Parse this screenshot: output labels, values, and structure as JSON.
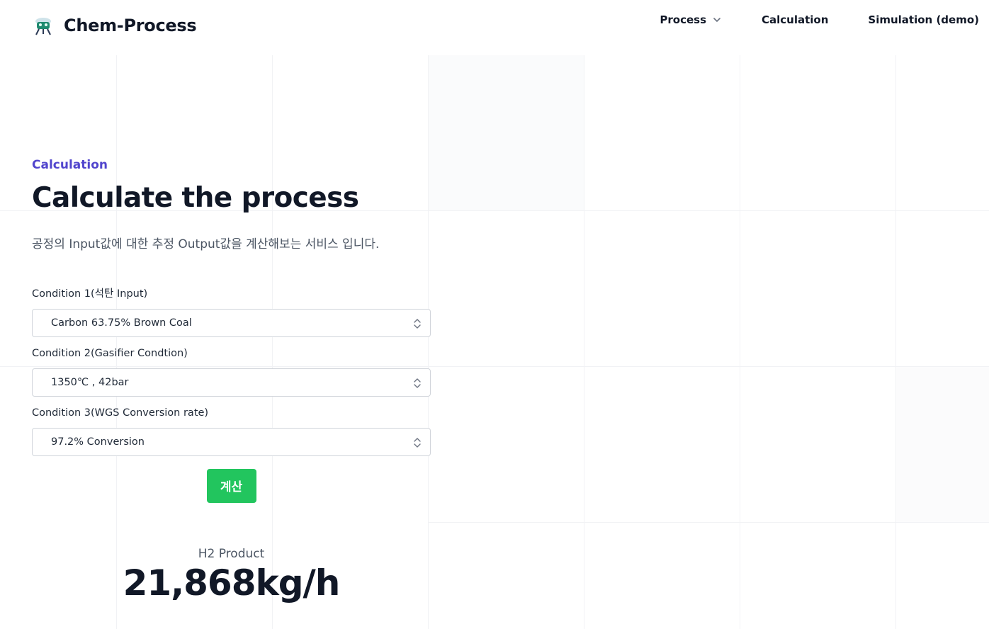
{
  "app": {
    "title": "Chem-Process",
    "logo_icon": "telescope-robot-icon"
  },
  "nav": {
    "items": [
      {
        "label": "Process",
        "has_dropdown": true
      },
      {
        "label": "Calculation"
      },
      {
        "label": "Simulation (demo)"
      }
    ]
  },
  "main": {
    "eyebrow": "Calculation",
    "title": "Calculate the process",
    "subtitle": "공정의 Input값에 대한 추정 Output값을 계산해보는 서비스 입니다."
  },
  "form": {
    "fields": [
      {
        "label": "Condition 1(석탄 Input)",
        "value": "Carbon 63.75% Brown Coal"
      },
      {
        "label": "Condition 2(Gasifier Condtion)",
        "value": "1350℃ , 42bar"
      },
      {
        "label": "Condition 3(WGS Conversion rate)",
        "value": "97.2% Conversion"
      }
    ],
    "submit_label": "계산"
  },
  "result": {
    "label": "H2 Product",
    "value": "21,868kg/h"
  },
  "colors": {
    "accent": "#5145cd",
    "button": "#22c55e",
    "text": "#111827"
  }
}
